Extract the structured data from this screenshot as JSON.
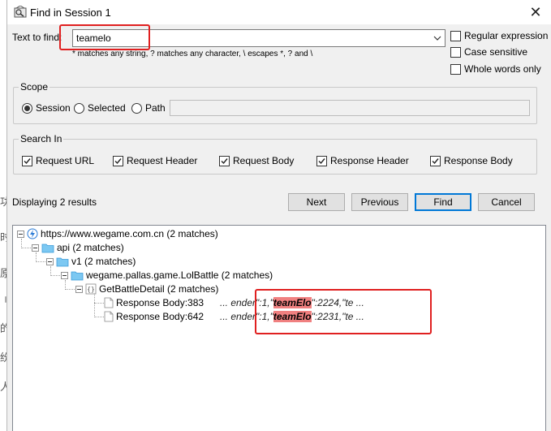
{
  "window": {
    "title": "Find in Session 1",
    "close_glyph": "✕"
  },
  "find": {
    "label": "Text to find:",
    "value": "teamelo",
    "hint": "* matches any string, ? matches any character, \\ escapes *, ? and \\"
  },
  "options": [
    {
      "label": "Regular expression",
      "checked": false
    },
    {
      "label": "Case sensitive",
      "checked": false
    },
    {
      "label": "Whole words only",
      "checked": false
    }
  ],
  "scope": {
    "title": "Scope",
    "options": [
      {
        "label": "Session",
        "selected": true
      },
      {
        "label": "Selected",
        "selected": false
      },
      {
        "label": "Path",
        "selected": false
      }
    ],
    "path_value": ""
  },
  "search_in": {
    "title": "Search In",
    "options": [
      {
        "label": "Request URL",
        "checked": true
      },
      {
        "label": "Request Header",
        "checked": true
      },
      {
        "label": "Request Body",
        "checked": true
      },
      {
        "label": "Response Header",
        "checked": true
      },
      {
        "label": "Response Body",
        "checked": true
      }
    ]
  },
  "status": "Displaying 2 results",
  "buttons": {
    "next": "Next",
    "previous": "Previous",
    "find": "Find",
    "cancel": "Cancel"
  },
  "results_tree": {
    "root": "https://www.wegame.com.cn (2 matches)",
    "api": "api (2 matches)",
    "v1": "v1 (2 matches)",
    "service": "wegame.pallas.game.LolBattle (2 matches)",
    "method": "GetBattleDetail (2 matches)",
    "results": [
      {
        "label": "Response Body:383",
        "pre": "... ender\":1,\"",
        "match": "teamElo",
        "post": "\":2224,\"te ..."
      },
      {
        "label": "Response Body:642",
        "pre": "... ender\":1,\"",
        "match": "teamElo",
        "post": "\":2231,\"te ..."
      }
    ]
  },
  "background_chars": [
    "功",
    "时",
    "原",
    "刂",
    "的",
    "纷",
    "人"
  ],
  "colors": {
    "highlight": "#f08080",
    "annotation": "#e02020",
    "primary_button_border": "#0078d7"
  }
}
